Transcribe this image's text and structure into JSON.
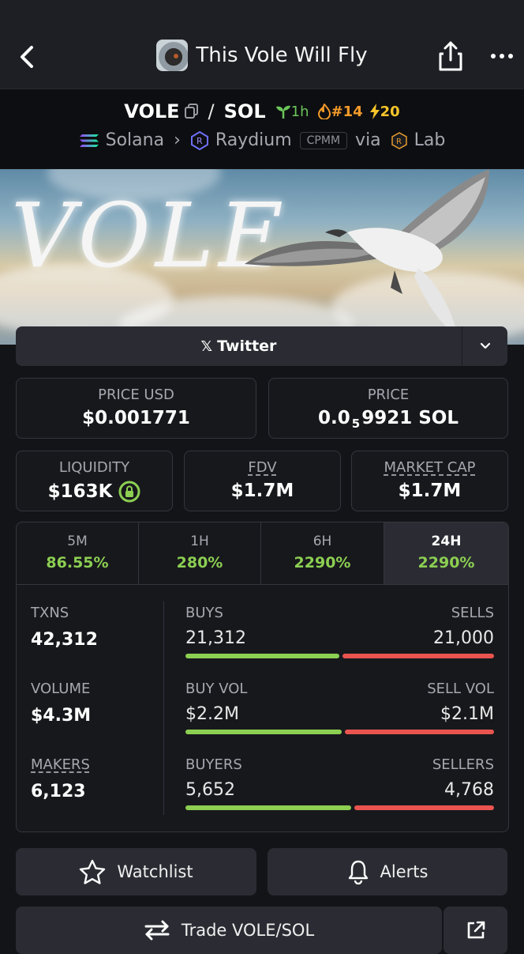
{
  "header": {
    "title": "This Vole Will Fly"
  },
  "pair": {
    "base": "VOLE",
    "quote": "SOL",
    "age": "1h",
    "rank": "#14",
    "boosts": "20",
    "chain": "Solana",
    "dex": "Raydium",
    "pool_type": "CPMM",
    "via_label": "via",
    "via": "Lab"
  },
  "banner": {
    "text": "VOLE"
  },
  "social": {
    "twitter_label": "Twitter"
  },
  "price": {
    "usd_label": "PRICE USD",
    "usd_value": "$0.001771",
    "native_label": "PRICE",
    "native_prefix": "0.0",
    "native_subscript": "5",
    "native_rest": "9921 SOL"
  },
  "metrics": {
    "liquidity_label": "LIQUIDITY",
    "liquidity_value": "$163K",
    "fdv_label": "FDV",
    "fdv_value": "$1.7M",
    "mcap_label": "MARKET CAP",
    "mcap_value": "$1.7M"
  },
  "timeframes": [
    {
      "label": "5M",
      "change": "86.55%"
    },
    {
      "label": "1H",
      "change": "280%"
    },
    {
      "label": "6H",
      "change": "2290%"
    },
    {
      "label": "24H",
      "change": "2290%"
    }
  ],
  "stats": {
    "txns_label": "TXNS",
    "txns_value": "42,312",
    "volume_label": "VOLUME",
    "volume_value": "$4.3M",
    "makers_label": "MAKERS",
    "makers_value": "6,123",
    "buys_label": "BUYS",
    "buys_value": "21,312",
    "sells_label": "SELLS",
    "sells_value": "21,000",
    "buyvol_label": "BUY VOL",
    "buyvol_value": "$2.2M",
    "sellvol_label": "SELL VOL",
    "sellvol_value": "$2.1M",
    "buyers_label": "BUYERS",
    "buyers_value": "5,652",
    "sellers_label": "SELLERS",
    "sellers_value": "4,768",
    "buys_share": 0.503,
    "buyvol_share": 0.512,
    "buyers_share": 0.542
  },
  "actions": {
    "watchlist": "Watchlist",
    "alerts": "Alerts",
    "trade": "Trade VOLE/SOL"
  },
  "colors": {
    "positive": "#8ccf52",
    "negative": "#e9544f",
    "background": "#131418"
  }
}
